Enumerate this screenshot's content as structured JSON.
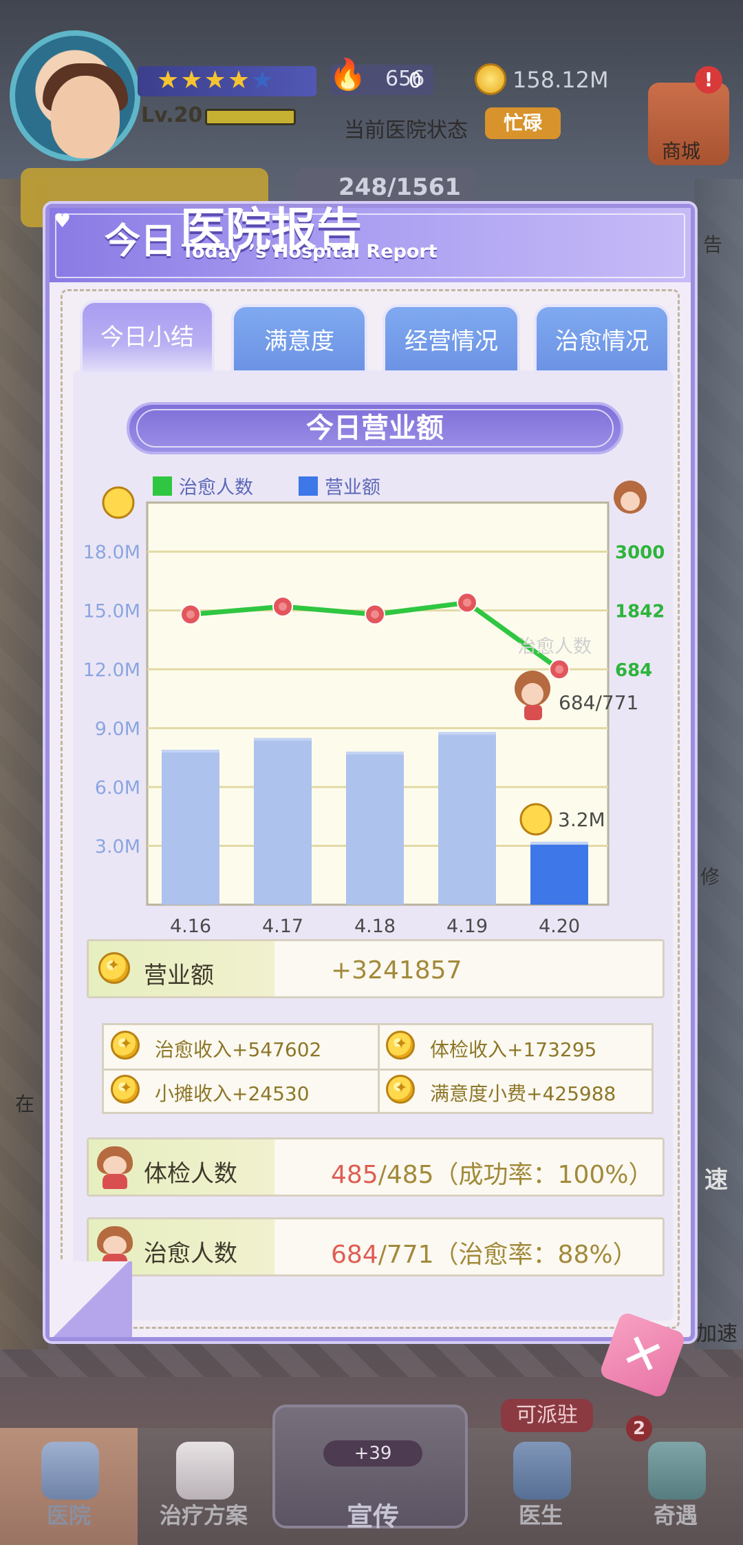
{
  "hud": {
    "level": "Lv.20",
    "gems": "656",
    "gems_secondary": "0",
    "coins": "158.12M",
    "hospital_status_label": "当前医院状态",
    "hospital_status": "忙碌",
    "shop_label": "商城",
    "shop_alert": "!",
    "behind_counter": "248/1561",
    "stars_filled": 4,
    "stars_total": 5
  },
  "side_labels": {
    "right_1": "告",
    "right_2": "修",
    "right_3": "速",
    "right_4": "加速",
    "left_1": "在"
  },
  "modal": {
    "title_part1": "今日",
    "title_part2": "医院报告",
    "title_en": "Today ’s Hospital Report",
    "tabs": [
      {
        "label": "今日小结",
        "active": true
      },
      {
        "label": "满意度",
        "active": false
      },
      {
        "label": "经营情况",
        "active": false
      },
      {
        "label": "治愈情况",
        "active": false
      }
    ],
    "section_title": "今日营业额"
  },
  "chart_data": {
    "type": "bar+line",
    "categories": [
      "4.16",
      "4.17",
      "4.18",
      "4.19",
      "4.20"
    ],
    "legend": [
      {
        "name": "治愈人数",
        "color": "#2fc641"
      },
      {
        "name": "营业额",
        "color": "#3d77e8"
      }
    ],
    "y_left": {
      "ticks": [
        "3.0M",
        "6.0M",
        "9.0M",
        "12.0M",
        "15.0M",
        "18.0M"
      ],
      "range": [
        0,
        20.5
      ]
    },
    "y_right": {
      "ticks": [
        "684",
        "1842",
        "3000"
      ]
    },
    "series": [
      {
        "name": "营业额",
        "type": "bar",
        "values": [
          7.9,
          8.5,
          7.8,
          8.8,
          3.2
        ],
        "units": "M"
      },
      {
        "name": "治愈人数",
        "type": "line",
        "values": [
          14.8,
          15.2,
          14.8,
          15.4,
          12.0
        ],
        "units": "M (left-axis scale)"
      }
    ],
    "annotations": {
      "last_bar_label": "3.2M",
      "line_end_label": "684/771",
      "line_faded_label": "治愈人数"
    },
    "colors": {
      "bar": "#aec2ee",
      "bar_highlight": "#3d77e8",
      "line": "#2fc641",
      "point": "#e2565b",
      "plot_bg": "#fdfcec",
      "grid": "#e2d9a6"
    }
  },
  "revenue": {
    "label": "营业额",
    "value": "+3241857"
  },
  "income": [
    {
      "label": "治愈收入+547602"
    },
    {
      "label": "体检收入+173295"
    },
    {
      "label": "小摊收入+24530"
    },
    {
      "label": "满意度小费+425988"
    }
  ],
  "checkup": {
    "label": "体检人数",
    "value_highlight": "485",
    "value_rest": "/485（成功率：100%）"
  },
  "cured": {
    "label": "治愈人数",
    "value_highlight": "684",
    "value_rest": "/771（治愈率：88%）"
  },
  "close_label": "✕",
  "nav": [
    {
      "label": "医院"
    },
    {
      "label": "治疗方案"
    },
    {
      "label": "宣传",
      "badge": "+39"
    },
    {
      "label": "医生",
      "badge": "可派驻"
    },
    {
      "label": "奇遇",
      "badge": "2"
    }
  ]
}
